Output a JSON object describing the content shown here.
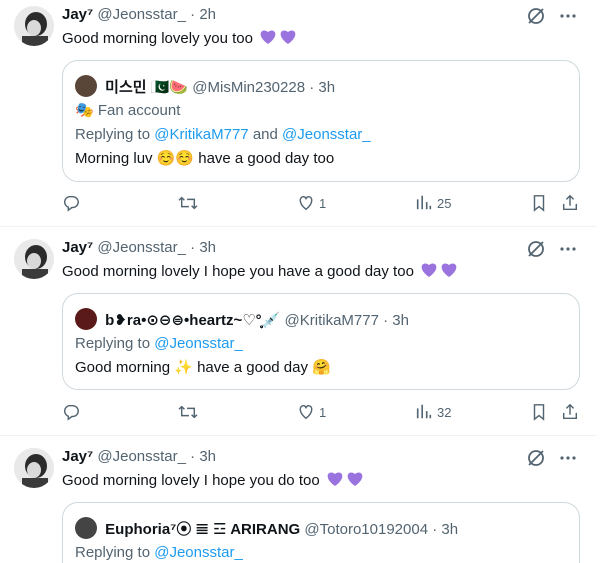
{
  "tweets": [
    {
      "author_name": "Jay⁷",
      "handle": "@Jeonsstar_",
      "time": "· 2h",
      "text": "Good morning lovely you too",
      "quote": {
        "name": "미스민 🇵🇰🍉",
        "handle": "@MisMin230228",
        "time": "· 3h",
        "label": "🎭 Fan account",
        "replying_prefix": "Replying to ",
        "replying_to_1": "@KritikaM777",
        "replying_and": " and ",
        "replying_to_2": "@Jeonsstar_",
        "text": "Morning luv ☺️☺️ have a good day too"
      },
      "actions": {
        "replies": "",
        "retweets": "",
        "likes": "1",
        "views": "25"
      }
    },
    {
      "author_name": "Jay⁷",
      "handle": "@Jeonsstar_",
      "time": "· 3h",
      "text": "Good morning lovely I hope you have a good day too",
      "quote": {
        "name": "b❥ra•⊙⊖⊜•heartz~♡°̥̥̥̥̥̥̥̥💉",
        "handle": "@KritikaM777",
        "time": "· 3h",
        "replying_prefix": "Replying to ",
        "replying_to_1": "@Jeonsstar_",
        "text": "Good morning ✨ have a good day 🤗"
      },
      "actions": {
        "replies": "",
        "retweets": "",
        "likes": "1",
        "views": "32"
      }
    },
    {
      "author_name": "Jay⁷",
      "handle": "@Jeonsstar_",
      "time": "· 3h",
      "text": "Good morning lovely I hope you do too",
      "quote": {
        "name": "Euphoria⁷⦿ 𝌆 ☲ ARIRANG",
        "handle": "@Totoro10192004",
        "time": "· 3h",
        "replying_prefix": "Replying to ",
        "replying_to_1": "@Jeonsstar_"
      }
    }
  ],
  "icons": {
    "grok": "grok-icon",
    "more": "more-icon",
    "reply": "reply-icon",
    "retweet": "retweet-icon",
    "like": "heart-icon",
    "views": "views-icon",
    "bookmark": "bookmark-icon",
    "share": "share-icon"
  },
  "colors": {
    "heart_purple": "#9b73de",
    "link": "#1d9bf0",
    "muted": "#536471"
  }
}
